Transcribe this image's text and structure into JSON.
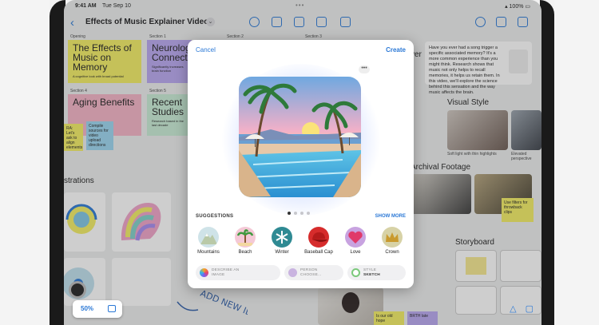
{
  "status": {
    "time": "9:41 AM",
    "date": "Tue Sep 10",
    "battery": "100%"
  },
  "toolbar": {
    "title": "Effects of Music Explainer Video"
  },
  "board": {
    "sections": [
      "Opening",
      "Section 1",
      "Section 2",
      "Section 3",
      "Section 4",
      "Section 5"
    ],
    "sticky_effects": "The Effects of Music on Memory",
    "sticky_effects_small": "A cognitive look with broad potential",
    "sticky_neuro": "Neurolog Connect",
    "sticky_neuro_small": "Significantly increases brain function",
    "sticky_aging": "Aging Benefits",
    "sticky_recent": "Recent Studies",
    "sticky_recent_small": "Research based in the last decade",
    "compile_note": "Compile sources for video upload directions",
    "ra_note": "RA: Let's ask to align elements",
    "illustrations": "strations",
    "over": "ver",
    "question": "Have you ever had a song trigger a specific associated memory? It's a more common experience than you might think. Research shows that music not only helps to recall memories, it helps us retain them. In this video, we'll explore the science behind this sensation and the way music affects the brain.",
    "visual_style": "Visual Style",
    "soft_light": "Soft light with thin highlights",
    "elevated": "Elevated perspective",
    "archival": "Archival Footage",
    "filters_note": "Use filters for throwback clips",
    "storyboard": "Storyboard",
    "add_new_ideas": "ADD NEW IDEAS",
    "bottom_note_1": "Is our old hope",
    "bottom_note_2": "BRTH late"
  },
  "zoom": {
    "value": "50%"
  },
  "modal": {
    "cancel": "Cancel",
    "create": "Create",
    "more": "•••",
    "suggestions_label": "SUGGESTIONS",
    "show_more": "SHOW MORE",
    "chips": [
      {
        "label": "Mountains",
        "icon": "mountain-icon",
        "color": "#cfe3e8"
      },
      {
        "label": "Beach",
        "icon": "palm-tree-icon",
        "color": "#f4c9d6"
      },
      {
        "label": "Winter",
        "icon": "snowflake-icon",
        "color": "#2f8a93"
      },
      {
        "label": "Baseball Cap",
        "icon": "cap-icon",
        "color": "#d62c2c"
      },
      {
        "label": "Love",
        "icon": "heart-icon",
        "color": "#c8a3e0"
      },
      {
        "label": "Crown",
        "icon": "crown-icon",
        "color": "#d7d2a6"
      }
    ],
    "describe": {
      "line1": "DESCRIBE AN",
      "line2": "IMAGE"
    },
    "person": {
      "line1": "PERSON",
      "line2": "CHOOSE..."
    },
    "style": {
      "line1": "STYLE",
      "line2": "SKETCH"
    }
  }
}
